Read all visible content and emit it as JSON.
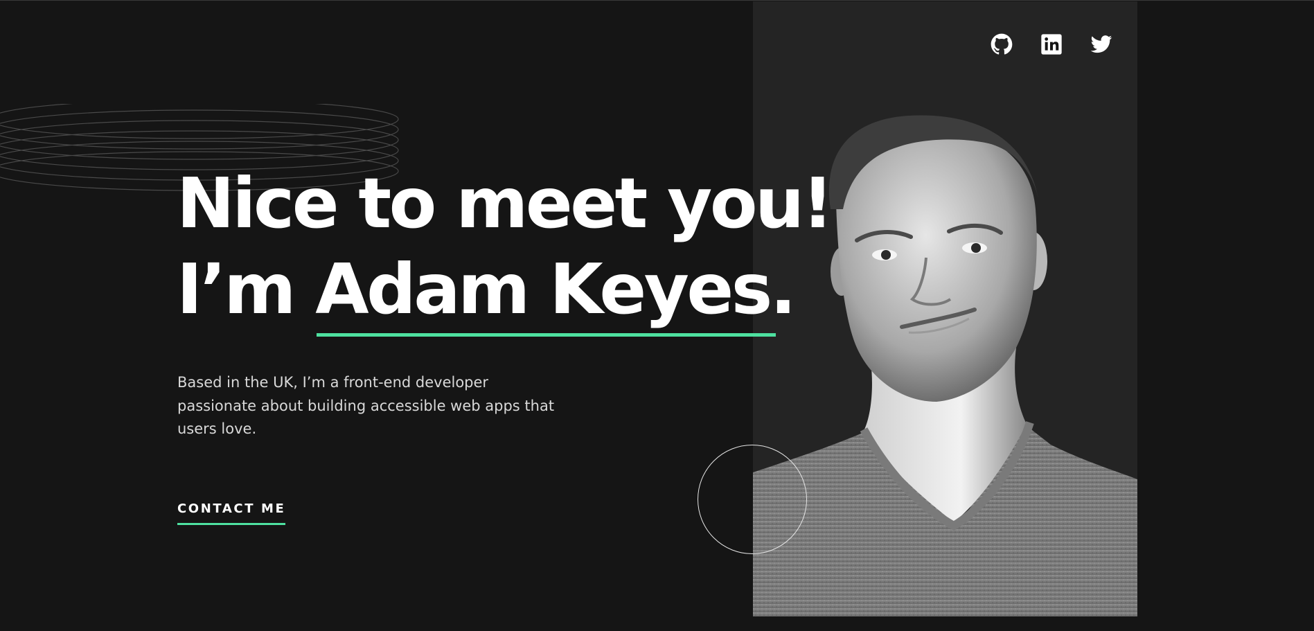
{
  "hero": {
    "headline_line1": "Nice to meet you!",
    "headline_prefix": "I’m ",
    "name": "Adam Keyes.",
    "intro": "Based in the UK, I’m a front-end developer passionate about building accessible web apps that users love.",
    "cta_label": "CONTACT ME"
  },
  "social": {
    "items": [
      {
        "name": "github",
        "icon": "github-icon"
      },
      {
        "name": "linkedin",
        "icon": "linkedin-icon"
      },
      {
        "name": "twitter",
        "icon": "twitter-icon"
      }
    ]
  },
  "colors": {
    "background": "#151515",
    "panel": "#242424",
    "accent": "#4ee1a0",
    "text": "#ffffff",
    "body_text": "#d9d9d9"
  }
}
